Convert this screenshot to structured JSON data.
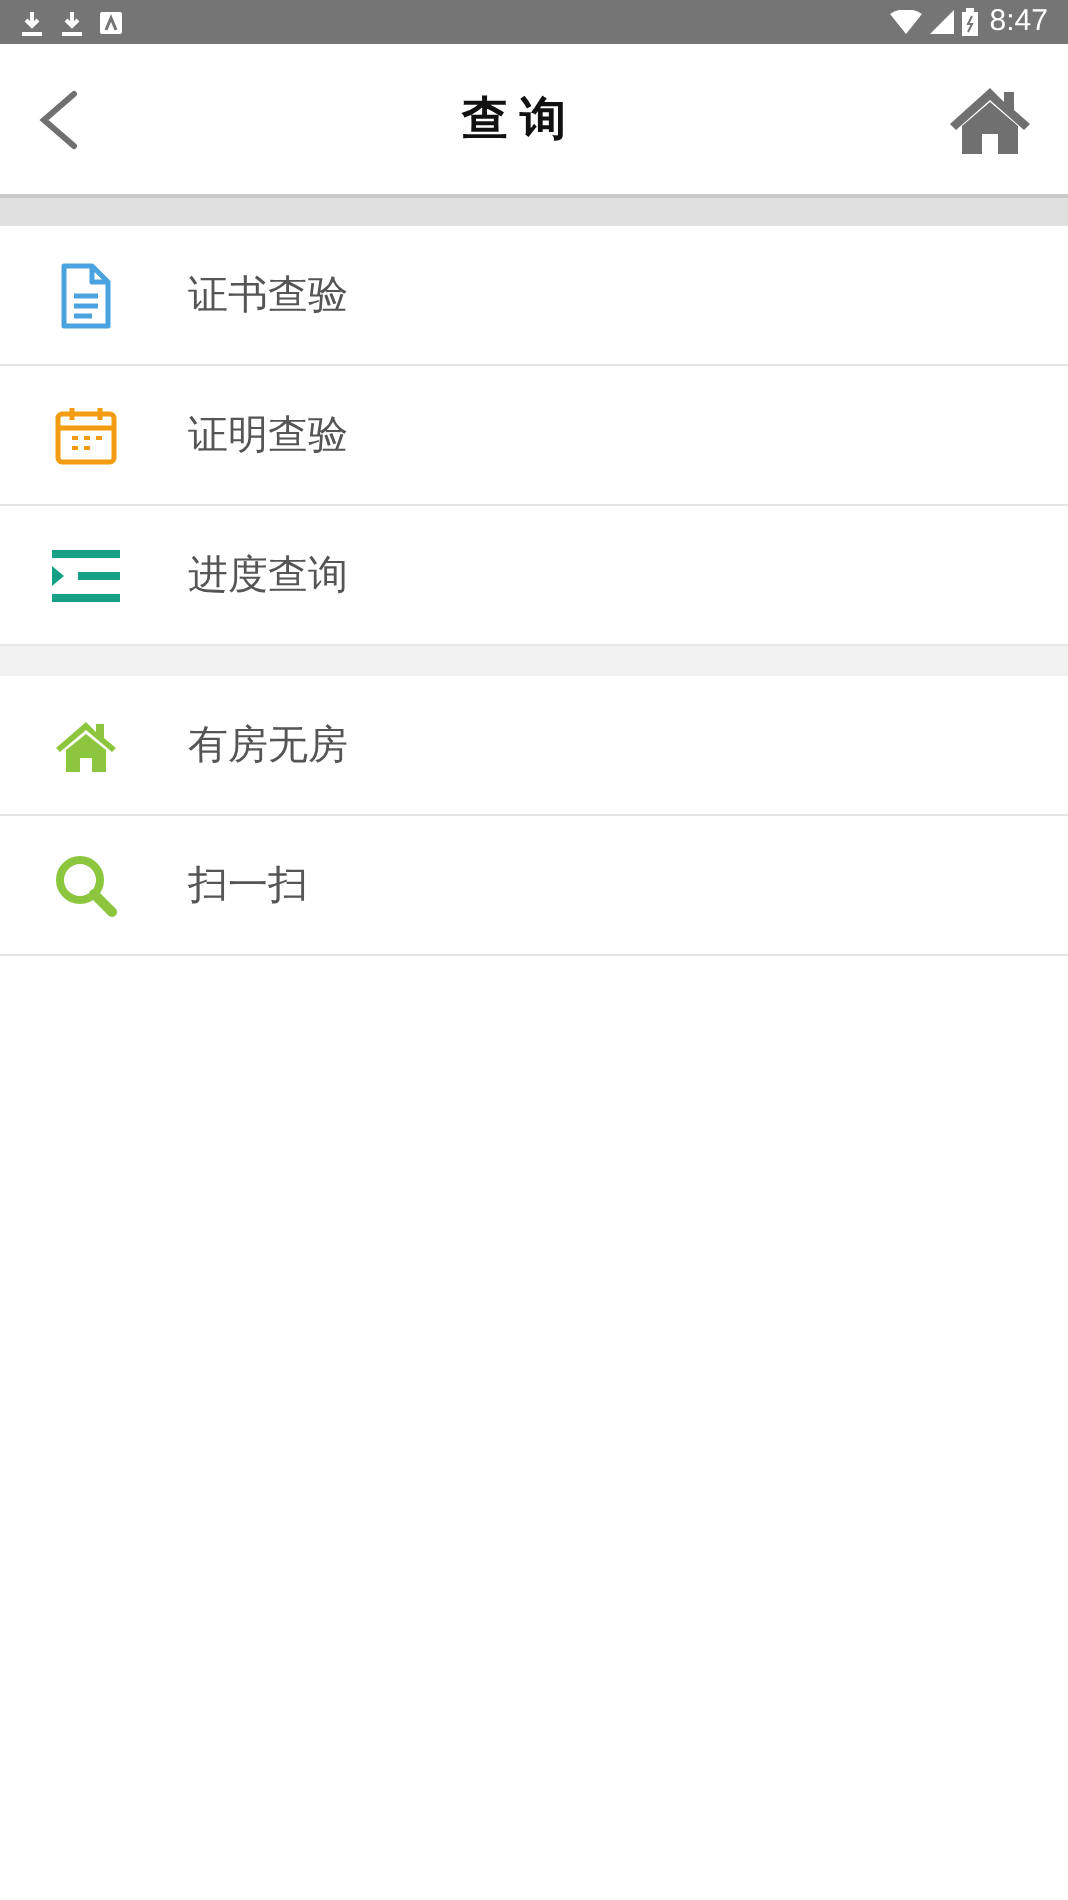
{
  "status_bar": {
    "time": "8:47"
  },
  "header": {
    "title": "查 询"
  },
  "groups": [
    [
      {
        "label": "证书查验",
        "kind": "document"
      },
      {
        "label": "证明查验",
        "kind": "calendar"
      },
      {
        "label": "进度查询",
        "kind": "list"
      }
    ],
    [
      {
        "label": "有房无房",
        "kind": "house"
      },
      {
        "label": "扫一扫",
        "kind": "search"
      }
    ]
  ]
}
